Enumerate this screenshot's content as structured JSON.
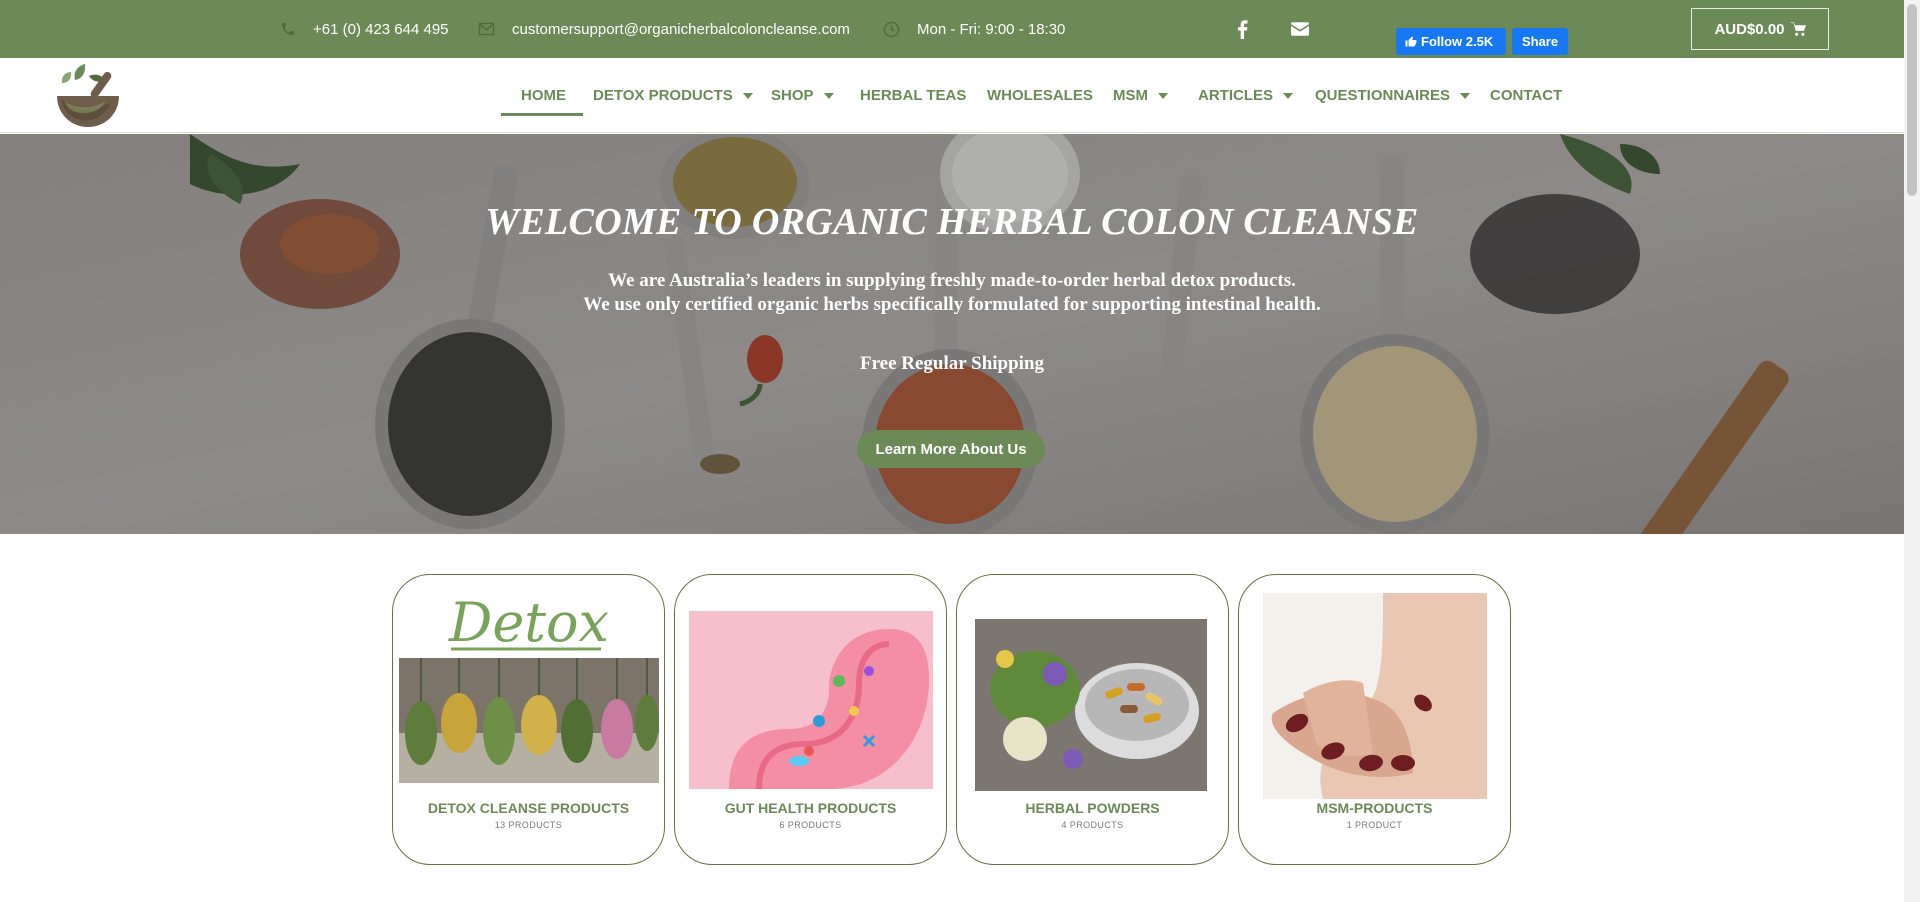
{
  "topbar": {
    "phone": "+61 (0) 423 644 495",
    "email": "customersupport@organicherbalcoloncleanse.com",
    "hours": "Mon - Fri: 9:00 - 18:30",
    "facebook_icon": "facebook-icon",
    "envelope_icon": "envelope-icon",
    "fb_follow_label": "Follow 2.5K",
    "fb_share_label": "Share",
    "cart_label": "AUD$0.00",
    "colors": {
      "bar": "#6b8a57",
      "icon": "#4f6b3c"
    }
  },
  "nav": {
    "items": [
      {
        "label": "HOME",
        "dropdown": false,
        "active": true
      },
      {
        "label": "DETOX PRODUCTS",
        "dropdown": true
      },
      {
        "label": "SHOP",
        "dropdown": true
      },
      {
        "label": "HERBAL TEAS",
        "dropdown": false
      },
      {
        "label": "WHOLESALES",
        "dropdown": false
      },
      {
        "label": "MSM",
        "dropdown": true
      },
      {
        "label": "ARTICLES",
        "dropdown": true
      },
      {
        "label": "QUESTIONNAIRES",
        "dropdown": true
      },
      {
        "label": "CONTACT",
        "dropdown": false
      }
    ],
    "accent": "#6b8a57"
  },
  "hero": {
    "title": "WELCOME TO ORGANIC HERBAL COLON CLEANSE",
    "line1": "We are Australia’s leaders in supplying freshly made-to-order herbal detox products.",
    "line2": "We use only certified organic herbs specifically formulated for supporting intestinal health.",
    "shipping": "Free Regular Shipping",
    "button_label": "Learn More About Us"
  },
  "categories": [
    {
      "name": "DETOX CLEANSE PRODUCTS",
      "count": "13 PRODUCTS",
      "image_text": "Detox"
    },
    {
      "name": "GUT HEALTH PRODUCTS",
      "count": "6 PRODUCTS"
    },
    {
      "name": "HERBAL POWDERS",
      "count": "4 PRODUCTS"
    },
    {
      "name": "MSM-PRODUCTS",
      "count": "1 PRODUCT"
    }
  ]
}
